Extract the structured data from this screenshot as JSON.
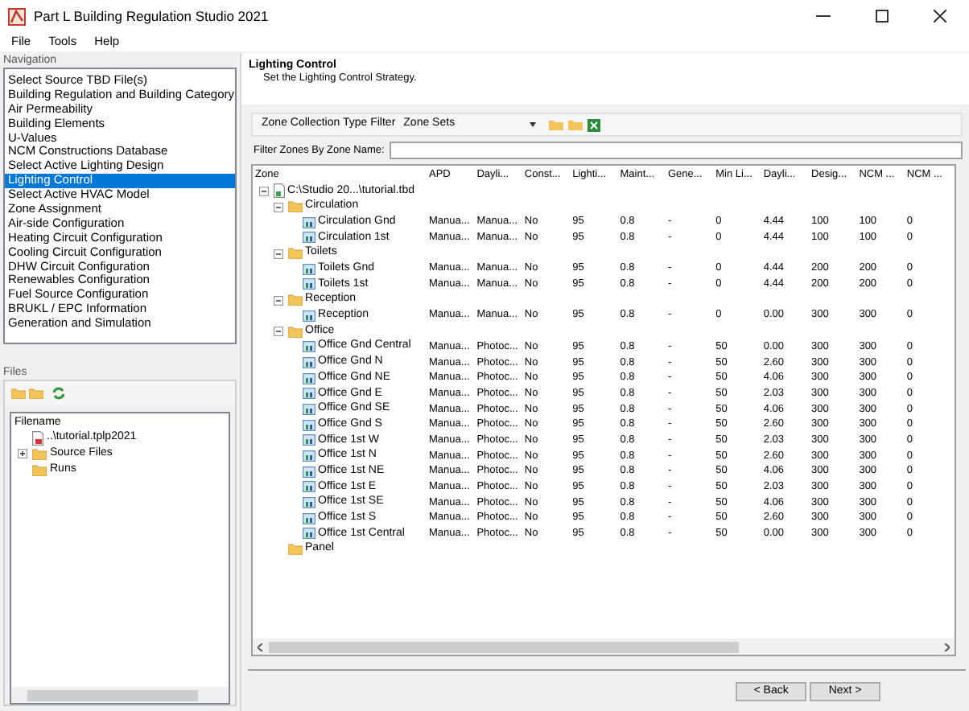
{
  "window": {
    "title": "Part L Building Regulation Studio 2021"
  },
  "menu": [
    "File",
    "Tools",
    "Help"
  ],
  "navigation": {
    "label": "Navigation",
    "items": [
      {
        "label": "Select Source TBD File(s)",
        "selected": false
      },
      {
        "label": "Building Regulation and Building Category",
        "selected": false
      },
      {
        "label": "Air Permeability",
        "selected": false
      },
      {
        "label": "Building Elements",
        "selected": false
      },
      {
        "label": "U-Values",
        "selected": false
      },
      {
        "label": "NCM Constructions Database",
        "selected": false
      },
      {
        "label": "Select Active Lighting Design",
        "selected": false
      },
      {
        "label": "Lighting Control",
        "selected": true
      },
      {
        "label": "Select Active HVAC Model",
        "selected": false
      },
      {
        "label": "Zone Assignment",
        "selected": false
      },
      {
        "label": "Air-side Configuration",
        "selected": false
      },
      {
        "label": "Heating Circuit Configuration",
        "selected": false
      },
      {
        "label": "Cooling Circuit Configuration",
        "selected": false
      },
      {
        "label": "DHW Circuit Configuration",
        "selected": false
      },
      {
        "label": "Renewables Configuration",
        "selected": false
      },
      {
        "label": "Fuel Source Configuration",
        "selected": false
      },
      {
        "label": "BRUKL / EPC Information",
        "selected": false
      },
      {
        "label": "Generation and Simulation",
        "selected": false
      }
    ]
  },
  "files": {
    "label": "Files",
    "header": "Filename",
    "items": [
      {
        "kind": "project",
        "label": "..\\tutorial.tplp2021"
      },
      {
        "kind": "folder",
        "label": "Source Files",
        "expanded": false
      },
      {
        "kind": "folder",
        "label": "Runs"
      }
    ]
  },
  "page": {
    "title": "Lighting Control",
    "subtitle": "Set the Lighting Control Strategy."
  },
  "toolbar": {
    "label": "Zone Collection Type Filter",
    "value": "Zone Sets"
  },
  "filter": {
    "label": "Filter Zones By Zone Name:"
  },
  "table": {
    "columns": [
      "Zone",
      "APD",
      "Dayli...",
      "Const...",
      "Lighti...",
      "Maint...",
      "Gene...",
      "Min Li...",
      "Dayli...",
      "Desig...",
      "NCM ...",
      "NCM ..."
    ],
    "rows": [
      {
        "kind": "file",
        "label": "C:\\Studio 20...\\tutorial.tbd",
        "expanded": true,
        "children": [
          {
            "kind": "folder",
            "label": "Circulation",
            "expanded": true,
            "children": [
              {
                "kind": "zone",
                "label": "Circulation Gnd",
                "values": [
                  "Manua...",
                  "Manua...",
                  "No",
                  "95",
                  "0.8",
                  "-",
                  "0",
                  "4.44",
                  "100",
                  "100",
                  "0"
                ]
              },
              {
                "kind": "zone",
                "label": "Circulation 1st",
                "values": [
                  "Manua...",
                  "Manua...",
                  "No",
                  "95",
                  "0.8",
                  "-",
                  "0",
                  "4.44",
                  "100",
                  "100",
                  "0"
                ]
              }
            ]
          },
          {
            "kind": "folder",
            "label": "Toilets",
            "expanded": true,
            "children": [
              {
                "kind": "zone",
                "label": "Toilets Gnd",
                "values": [
                  "Manua...",
                  "Manua...",
                  "No",
                  "95",
                  "0.8",
                  "-",
                  "0",
                  "4.44",
                  "200",
                  "200",
                  "0"
                ]
              },
              {
                "kind": "zone",
                "label": "Toilets 1st",
                "values": [
                  "Manua...",
                  "Manua...",
                  "No",
                  "95",
                  "0.8",
                  "-",
                  "0",
                  "4.44",
                  "200",
                  "200",
                  "0"
                ]
              }
            ]
          },
          {
            "kind": "folder",
            "label": "Reception",
            "expanded": true,
            "children": [
              {
                "kind": "zone",
                "label": "Reception",
                "values": [
                  "Manua...",
                  "Manua...",
                  "No",
                  "95",
                  "0.8",
                  "-",
                  "0",
                  "0.00",
                  "300",
                  "300",
                  "0"
                ]
              }
            ]
          },
          {
            "kind": "folder",
            "label": "Office",
            "expanded": true,
            "children": [
              {
                "kind": "zone",
                "label": "Office Gnd Central",
                "values": [
                  "Manua...",
                  "Photoc...",
                  "No",
                  "95",
                  "0.8",
                  "-",
                  "50",
                  "0.00",
                  "300",
                  "300",
                  "0"
                ]
              },
              {
                "kind": "zone",
                "label": "Office Gnd N",
                "values": [
                  "Manua...",
                  "Photoc...",
                  "No",
                  "95",
                  "0.8",
                  "-",
                  "50",
                  "2.60",
                  "300",
                  "300",
                  "0"
                ]
              },
              {
                "kind": "zone",
                "label": "Office Gnd NE",
                "values": [
                  "Manua...",
                  "Photoc...",
                  "No",
                  "95",
                  "0.8",
                  "-",
                  "50",
                  "4.06",
                  "300",
                  "300",
                  "0"
                ]
              },
              {
                "kind": "zone",
                "label": "Office Gnd E",
                "values": [
                  "Manua...",
                  "Photoc...",
                  "No",
                  "95",
                  "0.8",
                  "-",
                  "50",
                  "2.03",
                  "300",
                  "300",
                  "0"
                ]
              },
              {
                "kind": "zone",
                "label": "Office Gnd SE",
                "values": [
                  "Manua...",
                  "Photoc...",
                  "No",
                  "95",
                  "0.8",
                  "-",
                  "50",
                  "4.06",
                  "300",
                  "300",
                  "0"
                ]
              },
              {
                "kind": "zone",
                "label": "Office Gnd S",
                "values": [
                  "Manua...",
                  "Photoc...",
                  "No",
                  "95",
                  "0.8",
                  "-",
                  "50",
                  "2.60",
                  "300",
                  "300",
                  "0"
                ]
              },
              {
                "kind": "zone",
                "label": "Office 1st W",
                "values": [
                  "Manua...",
                  "Photoc...",
                  "No",
                  "95",
                  "0.8",
                  "-",
                  "50",
                  "2.03",
                  "300",
                  "300",
                  "0"
                ]
              },
              {
                "kind": "zone",
                "label": "Office 1st N",
                "values": [
                  "Manua...",
                  "Photoc...",
                  "No",
                  "95",
                  "0.8",
                  "-",
                  "50",
                  "2.60",
                  "300",
                  "300",
                  "0"
                ]
              },
              {
                "kind": "zone",
                "label": "Office 1st NE",
                "values": [
                  "Manua...",
                  "Photoc...",
                  "No",
                  "95",
                  "0.8",
                  "-",
                  "50",
                  "4.06",
                  "300",
                  "300",
                  "0"
                ]
              },
              {
                "kind": "zone",
                "label": "Office 1st E",
                "values": [
                  "Manua...",
                  "Photoc...",
                  "No",
                  "95",
                  "0.8",
                  "-",
                  "50",
                  "2.03",
                  "300",
                  "300",
                  "0"
                ]
              },
              {
                "kind": "zone",
                "label": "Office 1st SE",
                "values": [
                  "Manua...",
                  "Photoc...",
                  "No",
                  "95",
                  "0.8",
                  "-",
                  "50",
                  "4.06",
                  "300",
                  "300",
                  "0"
                ]
              },
              {
                "kind": "zone",
                "label": "Office 1st S",
                "values": [
                  "Manua...",
                  "Photoc...",
                  "No",
                  "95",
                  "0.8",
                  "-",
                  "50",
                  "2.60",
                  "300",
                  "300",
                  "0"
                ]
              },
              {
                "kind": "zone",
                "label": "Office 1st Central",
                "values": [
                  "Manua...",
                  "Photoc...",
                  "No",
                  "95",
                  "0.8",
                  "-",
                  "50",
                  "0.00",
                  "300",
                  "300",
                  "0"
                ]
              }
            ]
          },
          {
            "kind": "folder",
            "label": "Panel"
          }
        ]
      }
    ]
  },
  "buttons": [
    "< Back",
    "Next >"
  ]
}
